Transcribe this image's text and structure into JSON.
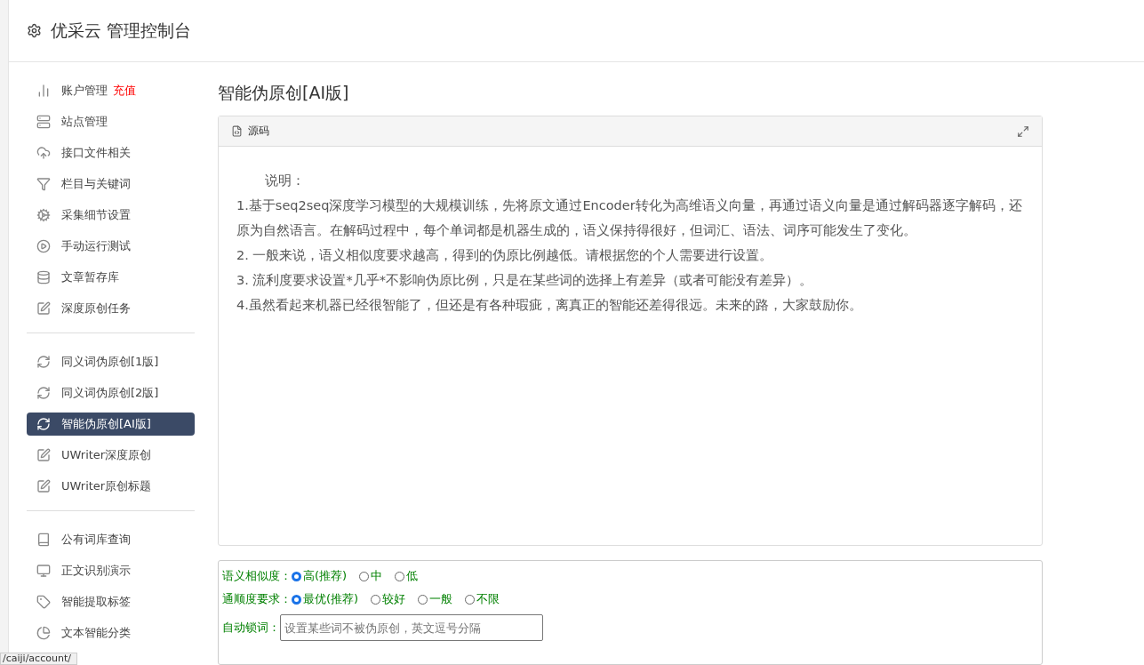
{
  "header": {
    "title": "优采云 管理控制台"
  },
  "sidebar": {
    "groups": [
      {
        "items": [
          {
            "label": "账户管理",
            "badge": "充值",
            "selected": false
          },
          {
            "label": "站点管理",
            "selected": false
          },
          {
            "label": "接口文件相关",
            "selected": false
          },
          {
            "label": "栏目与关键词",
            "selected": false
          },
          {
            "label": "采集细节设置",
            "selected": false
          },
          {
            "label": "手动运行测试",
            "selected": false
          },
          {
            "label": "文章暂存库",
            "selected": false
          },
          {
            "label": "深度原创任务",
            "selected": false
          }
        ]
      },
      {
        "items": [
          {
            "label": "同义词伪原创[1版]",
            "selected": false
          },
          {
            "label": "同义词伪原创[2版]",
            "selected": false
          },
          {
            "label": "智能伪原创[AI版]",
            "selected": true
          },
          {
            "label": "UWriter深度原创",
            "selected": false
          },
          {
            "label": "UWriter原创标题",
            "selected": false
          }
        ]
      },
      {
        "items": [
          {
            "label": "公有词库查询",
            "selected": false
          },
          {
            "label": "正文识别演示",
            "selected": false
          },
          {
            "label": "智能提取标签",
            "selected": false
          },
          {
            "label": "文本智能分类",
            "selected": false
          }
        ]
      }
    ]
  },
  "main": {
    "title": "智能伪原创[AI版]",
    "editor": {
      "tab": "源码",
      "lines": [
        "说明：",
        "1.基于seq2seq深度学习模型的大规模训练，先将原文通过Encoder转化为高维语义向量，再通过语义向量是通过解码器逐字解码，还原为自然语言。在解码过程中，每个单词都是机器生成的，语义保持得很好，但词汇、语法、词序可能发生了变化。",
        "2. 一般来说，语义相似度要求越高，得到的伪原比例越低。请根据您的个人需要进行设置。",
        "3. 流利度要求设置*几乎*不影响伪原比例，只是在某些词的选择上有差异（或者可能没有差异）。",
        "4.虽然看起来机器已经很智能了，但还是有各种瑕疵，离真正的智能还差得很远。未来的路，大家鼓励你。"
      ]
    },
    "options": [
      {
        "label": "语义相似度：",
        "choices": [
          {
            "label": "高(推荐)",
            "selected": true
          },
          {
            "label": "中",
            "selected": false
          },
          {
            "label": "低",
            "selected": false
          }
        ]
      },
      {
        "label": "通顺度要求：",
        "choices": [
          {
            "label": "最优(推荐)",
            "selected": true
          },
          {
            "label": "较好",
            "selected": false
          },
          {
            "label": "一般",
            "selected": false
          },
          {
            "label": "不限",
            "selected": false
          }
        ]
      }
    ],
    "lock_words": {
      "label": "自动锁词：",
      "placeholder": "设置某些词不被伪原创，英文逗号分隔"
    }
  },
  "status_bar": {
    "url": "/caiji/account/"
  }
}
